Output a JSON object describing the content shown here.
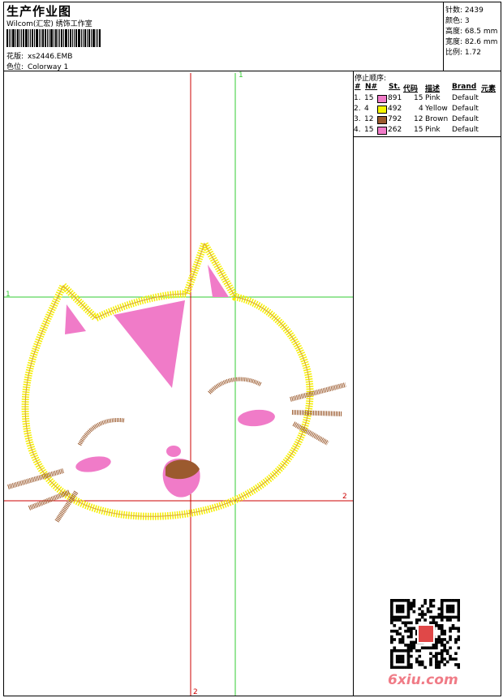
{
  "header": {
    "title": "生产作业图",
    "company": "Wilcom(汇宏) 绣饰工作室",
    "design_label": "花版:",
    "design_value": "xs2446.EMB",
    "colorway_label": "色位:",
    "colorway_value": "Colorway 1"
  },
  "stats": [
    {
      "label": "针数:",
      "value": "2439"
    },
    {
      "label": "颜色:",
      "value": "3"
    },
    {
      "label": "高度:",
      "value": "68.5 mm"
    },
    {
      "label": "宽度:",
      "value": "82.6 mm"
    },
    {
      "label": "比例:",
      "value": "1.72"
    }
  ],
  "sequence": {
    "title": "停止顺序:",
    "headers": {
      "index": "#",
      "needle": "N#",
      "stitches": "St.",
      "code": "代码",
      "desc": "描述",
      "brand": "Brand",
      "element": "元素"
    },
    "rows": [
      {
        "index": "1.",
        "needle": "15",
        "code": "891",
        "stitches": "15",
        "desc": "Pink",
        "brand": "Default",
        "color": "#f07bc8"
      },
      {
        "index": "2.",
        "needle": "4",
        "code": "492",
        "stitches": "4",
        "desc": "Yellow",
        "brand": "Default",
        "color": "#f5f500"
      },
      {
        "index": "3.",
        "needle": "12",
        "code": "792",
        "stitches": "12",
        "desc": "Brown",
        "brand": "Default",
        "color": "#9b5a2e"
      },
      {
        "index": "4.",
        "needle": "15",
        "code": "262",
        "stitches": "15",
        "desc": "Pink",
        "brand": "Default",
        "color": "#f07bc8"
      }
    ]
  },
  "guides": {
    "v1": "1",
    "h1": "1",
    "h2": "2",
    "v2": "2"
  },
  "watermark": "6xiu.com",
  "colors": {
    "guide_green": "#33cc33",
    "guide_red": "#cc0000",
    "outline_yellow": "#f2f200",
    "pink": "#f07bc8",
    "brown": "#9b5a2e"
  }
}
